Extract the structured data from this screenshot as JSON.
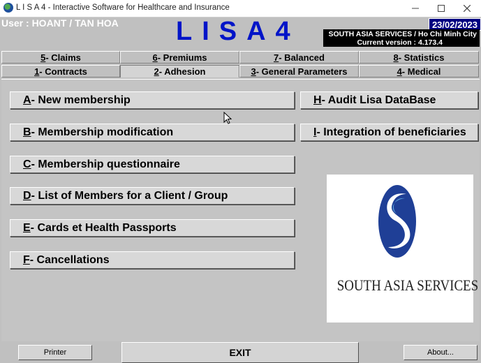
{
  "window": {
    "title": "L I S A 4 - Interactive Software for Healthcare and Insurance",
    "controls": [
      "minimize-icon",
      "maximize-icon",
      "close-icon"
    ]
  },
  "header": {
    "user": "User : HOANT / TAN HOA",
    "logo": "LISA4",
    "date": "23/02/2023",
    "company": "SOUTH ASIA SERVICES / Ho Chi Minh City",
    "version": "Current version : 4.173.4"
  },
  "tabs": {
    "row1": [
      {
        "key": "5",
        "label": " - Claims"
      },
      {
        "key": "6",
        "label": " - Premiums"
      },
      {
        "key": "7",
        "label": " - Balanced"
      },
      {
        "key": "8",
        "label": " - Statistics"
      }
    ],
    "row2": [
      {
        "key": "1",
        "label": " - Contracts"
      },
      {
        "key": "2",
        "label": " - Adhesion"
      },
      {
        "key": "3",
        "label": " - General Parameters"
      },
      {
        "key": "4",
        "label": " - Medical"
      }
    ],
    "active": "2 - Adhesion"
  },
  "menu": {
    "left": [
      {
        "key": "A",
        "label": " - New membership"
      },
      {
        "key": "B",
        "label": " - Membership modification"
      },
      {
        "key": "C",
        "label": " - Membership questionnaire"
      },
      {
        "key": "D",
        "label": " - List of Members for a Client / Group"
      },
      {
        "key": "E",
        "label": " - Cards et Health Passports"
      },
      {
        "key": "F",
        "label": " - Cancellations"
      }
    ],
    "right": [
      {
        "key": "H",
        "label": " - Audit Lisa DataBase"
      },
      {
        "key": "I",
        "label": " - Integration of beneficiaries"
      }
    ]
  },
  "brand_logo": {
    "name": "SOUTH ASIA SERVICES",
    "colors": {
      "blue": "#1f3f96",
      "light_blue": "#5aa0d8"
    }
  },
  "footer": {
    "printer": "Printer",
    "exit": "EXIT",
    "about": "About..."
  },
  "colors": {
    "logo_text": "#0014c8",
    "date_bg": "#000080",
    "window_bg": "#c0c0c0"
  }
}
